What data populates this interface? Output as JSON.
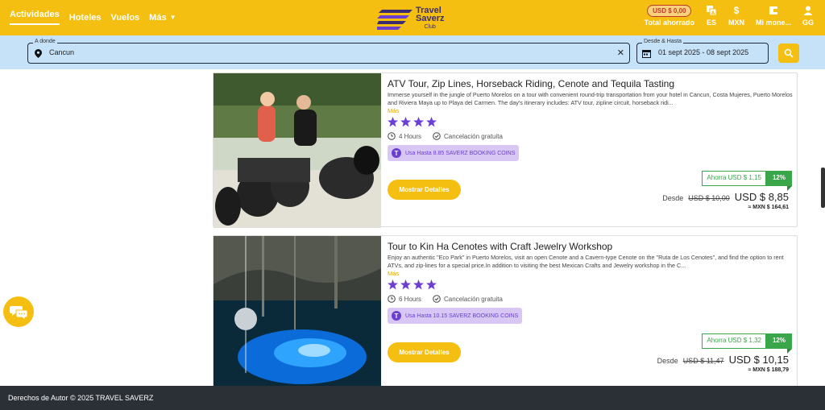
{
  "header": {
    "nav": [
      {
        "label": "Actividades",
        "active": true
      },
      {
        "label": "Hoteles",
        "active": false
      },
      {
        "label": "Vuelos",
        "active": false
      },
      {
        "label": "Más",
        "active": false
      }
    ],
    "logo": {
      "line1": "Travel",
      "line2": "Saverz",
      "line3": "Club"
    },
    "saved_amount": "USD $ 0,00",
    "saved_label": "Total ahorrado",
    "language": "ES",
    "currency_symbol": "$",
    "currency": "MXN",
    "wallet_label": "Mi mone...",
    "user_label": "GG"
  },
  "search": {
    "destination_label": "A donde",
    "destination_value": "Cancun",
    "dates_label": "Desde & Hasta",
    "dates_value": "01 sept 2025  -  08 sept 2025"
  },
  "cards": [
    {
      "title": "ATV Tour, Zip Lines, Horseback Riding, Cenote and Tequila Tasting",
      "description": "Immerse yourself in the jungle of Puerto Morelos on a tour with convenient round-trip transportation from your hotel in Cancun, Costa Mujeres, Puerto Morelos and Riviera Maya up to Playa del Carmen. The day's itinerary includes: ATV tour, zipline circuit, horseback ridi...",
      "more": "Más",
      "rating": 4,
      "duration": "4 Hours",
      "cancellation": "Cancelación gratuita",
      "coins": "Usa Hasta 8.85 SAVERZ BOOKING COINS",
      "button": "Mostrar Detalles",
      "savings": "Ahorra USD $ 1,15",
      "discount": "12%",
      "from": "Desde",
      "old_price": "USD $ 10,00",
      "price": "USD $ 8,85",
      "mxn": "≈ MXN $ 164,61"
    },
    {
      "title": "Tour to Kin Ha Cenotes with Craft Jewelry Workshop",
      "description": "Enjoy an authentic \"Eco Park\" in Puerto Morelos, visit an open Cenote and a Cavern-type Cenote on the \"Ruta de Los Cenotes\", and find the option to rent ATVs, and zip-lines for a special price.In addition to visiting the best Mexican Crafts and Jewelry workshop in the C...",
      "more": "Más",
      "rating": 4,
      "duration": "6 Hours",
      "cancellation": "Cancelación gratuita",
      "coins": "Usa Hasta 10.15 SAVERZ BOOKING COINS",
      "button": "Mostrar Detalles",
      "savings": "Ahorra USD $ 1,32",
      "discount": "12%",
      "from": "Desde",
      "old_price": "USD $ 11,47",
      "price": "USD $ 10,15",
      "mxn": "≈ MXN $ 188,79"
    }
  ],
  "footer": {
    "copyright": "Derechos de Autor © 2025 TRAVEL SAVERZ"
  },
  "colors": {
    "brand": "#f5bf11",
    "search_bg": "#c6e2f8",
    "coin_purple": "#6a3fd0",
    "savings_green": "#3aa64a",
    "footer_bg": "#2b2f36"
  }
}
